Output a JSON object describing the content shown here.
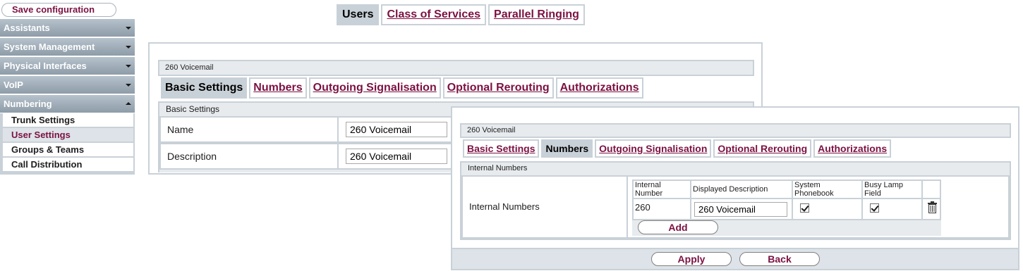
{
  "sidebar": {
    "save_label": "Save configuration",
    "menus": [
      {
        "label": "Assistants",
        "expanded": false
      },
      {
        "label": "System Management",
        "expanded": false
      },
      {
        "label": "Physical Interfaces",
        "expanded": false
      },
      {
        "label": "VoIP",
        "expanded": false
      },
      {
        "label": "Numbering",
        "expanded": true
      }
    ],
    "subitems": [
      {
        "label": "Trunk Settings",
        "active": false
      },
      {
        "label": "User Settings",
        "active": true
      },
      {
        "label": "Groups & Teams",
        "active": false
      },
      {
        "label": "Call Distribution",
        "active": false
      }
    ]
  },
  "top_tabs": [
    {
      "label": "Users",
      "active": true
    },
    {
      "label": "Class of Services",
      "active": false
    },
    {
      "label": "Parallel Ringing",
      "active": false
    }
  ],
  "back_panel": {
    "title": "260 Voicemail",
    "tabs": [
      {
        "label": "Basic Settings",
        "active": true
      },
      {
        "label": "Numbers",
        "active": false
      },
      {
        "label": "Outgoing Signalisation",
        "active": false
      },
      {
        "label": "Optional Rerouting",
        "active": false
      },
      {
        "label": "Authorizations",
        "active": false
      }
    ],
    "section": "Basic Settings",
    "fields": [
      {
        "label": "Name",
        "value": "260 Voicemail"
      },
      {
        "label": "Description",
        "value": "260 Voicemail"
      }
    ]
  },
  "front_panel": {
    "title": "260 Voicemail",
    "tabs": [
      {
        "label": "Basic Settings",
        "active": false
      },
      {
        "label": "Numbers",
        "active": true
      },
      {
        "label": "Outgoing Signalisation",
        "active": false
      },
      {
        "label": "Optional Rerouting",
        "active": false
      },
      {
        "label": "Authorizations",
        "active": false
      }
    ],
    "section": "Internal Numbers",
    "row_label": "Internal Numbers",
    "columns": [
      "Internal Number",
      "Displayed Description",
      "System Phonebook",
      "Busy Lamp Field"
    ],
    "rows": [
      {
        "internal_number": "260",
        "description": "260 Voicemail",
        "system_phonebook": true,
        "busy_lamp_field": true
      }
    ],
    "add_label": "Add",
    "apply_label": "Apply",
    "back_label": "Back"
  },
  "colors": {
    "accent": "#7b1142",
    "border": "#c9d1d8",
    "menu_gradient_top": "#b6c2cc",
    "menu_gradient_bottom": "#8e9ca8",
    "section_bg": "#e7ebee"
  },
  "icons": {
    "expand": "chevron-down-icon",
    "collapse": "chevron-up-icon",
    "delete": "trash-icon",
    "checked": "checkbox-checked-icon"
  }
}
